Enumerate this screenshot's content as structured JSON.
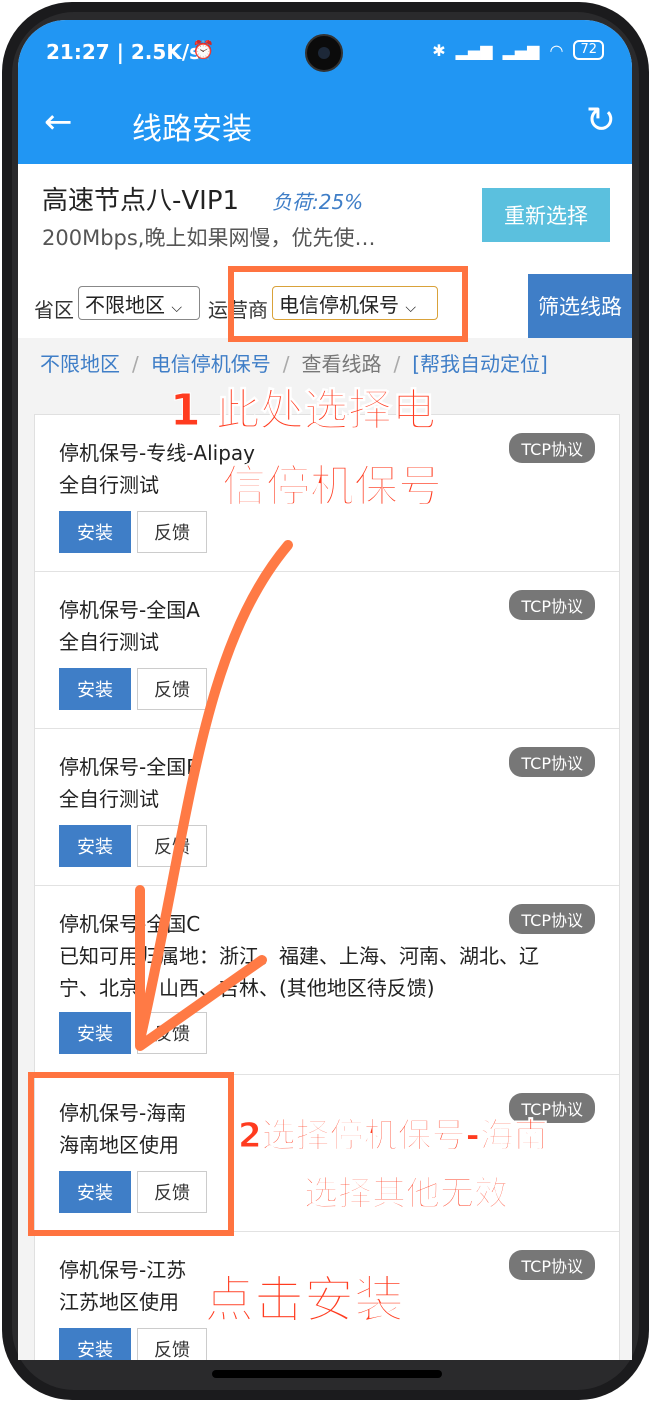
{
  "status_bar": {
    "time_speed": "21:27 | 2.5K/s",
    "battery": "72"
  },
  "app_bar": {
    "title": "线路安装"
  },
  "node": {
    "name": "高速节点八-VIP1",
    "load": "负荷:25%",
    "desc": "200Mbps,晚上如果网慢，优先使…",
    "reselect": "重新选择"
  },
  "filter": {
    "province_label": "省区",
    "province_value": "不限地区",
    "carrier_label": "运营商",
    "carrier_value": "电信停机保号",
    "submit": "筛选线路"
  },
  "breadcrumb": {
    "region": "不限地区",
    "carrier": "电信停机保号",
    "view": "查看线路",
    "auto": "[帮我自动定位]"
  },
  "lines": [
    {
      "name": "停机保号-专线-Alipay",
      "note": "全自行测试",
      "note2": "",
      "tag": "TCP协议",
      "install": "安装",
      "feedback": "反馈"
    },
    {
      "name": "停机保号-全国A",
      "note": "全自行测试",
      "note2": "",
      "tag": "TCP协议",
      "install": "安装",
      "feedback": "反馈"
    },
    {
      "name": "停机保号-全国B",
      "note": "全自行测试",
      "note2": "",
      "tag": "TCP协议",
      "install": "安装",
      "feedback": "反馈"
    },
    {
      "name": "停机保号-全国C",
      "note": "已知可用归属地：浙江、福建、上海、河南、湖北、辽",
      "note2": "宁、北京、山西、吉林、(其他地区待反馈)",
      "tag": "TCP协议",
      "install": "安装",
      "feedback": "反馈"
    },
    {
      "name": "停机保号-海南",
      "note": "海南地区使用",
      "note2": "",
      "tag": "TCP协议",
      "install": "安装",
      "feedback": "反馈"
    },
    {
      "name": "停机保号-江苏",
      "note": "江苏地区使用",
      "note2": "",
      "tag": "TCP协议",
      "install": "安装",
      "feedback": "反馈"
    }
  ],
  "annotations": {
    "step1_line1": "1 此处选择电",
    "step1_line2": "信停机保号",
    "step2_line1": "2选择停机保号-海南",
    "step2_line2": "选择其他无效",
    "step3": "点击安装"
  },
  "colors": {
    "primary": "#2196f3",
    "button": "#3f7ec7",
    "accent": "#5bc0de",
    "annotation": "#ff7340"
  }
}
